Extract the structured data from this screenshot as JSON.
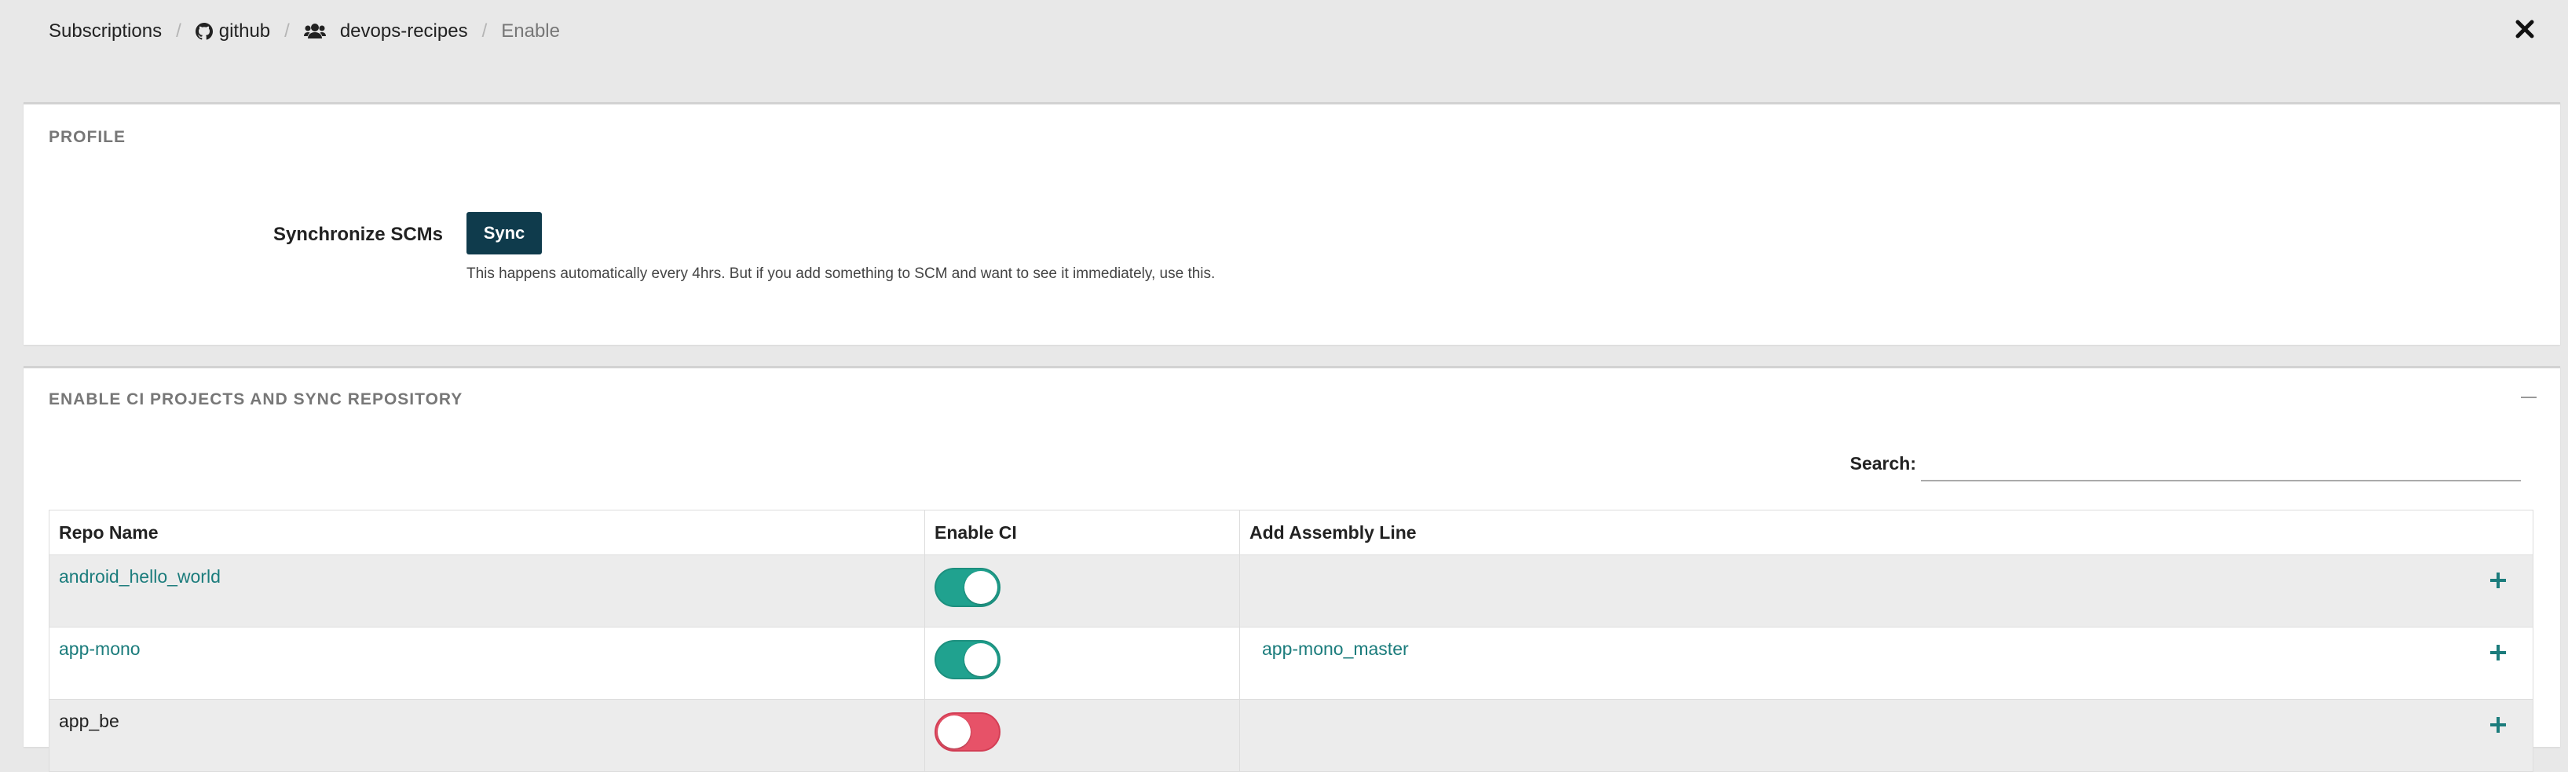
{
  "breadcrumb": {
    "items": [
      {
        "label": "Subscriptions",
        "icon": ""
      },
      {
        "label": "github",
        "icon": "github-icon"
      },
      {
        "label": "devops-recipes",
        "icon": "users-icon"
      },
      {
        "label": "Enable",
        "icon": ""
      }
    ],
    "separator": "/"
  },
  "profile": {
    "title": "PROFILE",
    "sync_label": "Synchronize SCMs",
    "sync_button": "Sync",
    "sync_help": "This happens automatically every 4hrs. But if you add something to SCM and want to see it immediately, use this."
  },
  "enable": {
    "title": "ENABLE CI PROJECTS AND SYNC REPOSITORY",
    "search_label": "Search:",
    "search_value": "",
    "columns": [
      "Repo Name",
      "Enable CI",
      "Add Assembly Line"
    ],
    "rows": [
      {
        "repo": "android_hello_world",
        "enabled": true,
        "assembly_line": ""
      },
      {
        "repo": "app-mono",
        "enabled": true,
        "assembly_line": "app-mono_master"
      },
      {
        "repo": "app_be",
        "enabled": false,
        "assembly_line": ""
      }
    ]
  },
  "colors": {
    "accent": "#1b7c7c",
    "toggle_on": "#20a28f",
    "toggle_off": "#e75268",
    "sync_button": "#0f3b4c"
  }
}
